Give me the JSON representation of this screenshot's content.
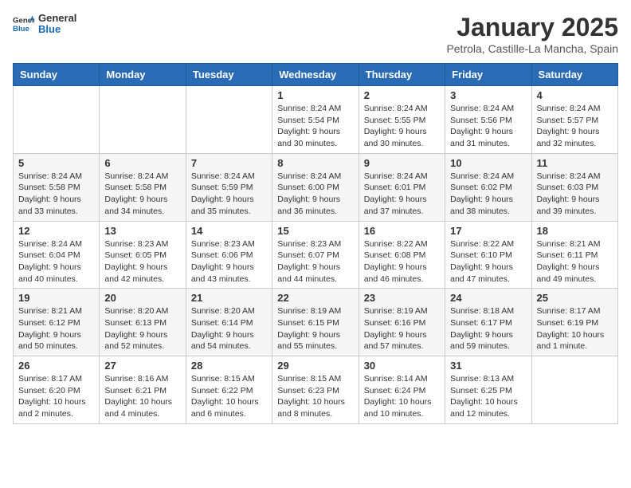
{
  "header": {
    "logo_general": "General",
    "logo_blue": "Blue",
    "month_title": "January 2025",
    "subtitle": "Petrola, Castille-La Mancha, Spain"
  },
  "weekdays": [
    "Sunday",
    "Monday",
    "Tuesday",
    "Wednesday",
    "Thursday",
    "Friday",
    "Saturday"
  ],
  "weeks": [
    [
      {
        "day": null,
        "info": null
      },
      {
        "day": null,
        "info": null
      },
      {
        "day": null,
        "info": null
      },
      {
        "day": "1",
        "info": "Sunrise: 8:24 AM\nSunset: 5:54 PM\nDaylight: 9 hours and 30 minutes."
      },
      {
        "day": "2",
        "info": "Sunrise: 8:24 AM\nSunset: 5:55 PM\nDaylight: 9 hours and 30 minutes."
      },
      {
        "day": "3",
        "info": "Sunrise: 8:24 AM\nSunset: 5:56 PM\nDaylight: 9 hours and 31 minutes."
      },
      {
        "day": "4",
        "info": "Sunrise: 8:24 AM\nSunset: 5:57 PM\nDaylight: 9 hours and 32 minutes."
      }
    ],
    [
      {
        "day": "5",
        "info": "Sunrise: 8:24 AM\nSunset: 5:58 PM\nDaylight: 9 hours and 33 minutes."
      },
      {
        "day": "6",
        "info": "Sunrise: 8:24 AM\nSunset: 5:58 PM\nDaylight: 9 hours and 34 minutes."
      },
      {
        "day": "7",
        "info": "Sunrise: 8:24 AM\nSunset: 5:59 PM\nDaylight: 9 hours and 35 minutes."
      },
      {
        "day": "8",
        "info": "Sunrise: 8:24 AM\nSunset: 6:00 PM\nDaylight: 9 hours and 36 minutes."
      },
      {
        "day": "9",
        "info": "Sunrise: 8:24 AM\nSunset: 6:01 PM\nDaylight: 9 hours and 37 minutes."
      },
      {
        "day": "10",
        "info": "Sunrise: 8:24 AM\nSunset: 6:02 PM\nDaylight: 9 hours and 38 minutes."
      },
      {
        "day": "11",
        "info": "Sunrise: 8:24 AM\nSunset: 6:03 PM\nDaylight: 9 hours and 39 minutes."
      }
    ],
    [
      {
        "day": "12",
        "info": "Sunrise: 8:24 AM\nSunset: 6:04 PM\nDaylight: 9 hours and 40 minutes."
      },
      {
        "day": "13",
        "info": "Sunrise: 8:23 AM\nSunset: 6:05 PM\nDaylight: 9 hours and 42 minutes."
      },
      {
        "day": "14",
        "info": "Sunrise: 8:23 AM\nSunset: 6:06 PM\nDaylight: 9 hours and 43 minutes."
      },
      {
        "day": "15",
        "info": "Sunrise: 8:23 AM\nSunset: 6:07 PM\nDaylight: 9 hours and 44 minutes."
      },
      {
        "day": "16",
        "info": "Sunrise: 8:22 AM\nSunset: 6:08 PM\nDaylight: 9 hours and 46 minutes."
      },
      {
        "day": "17",
        "info": "Sunrise: 8:22 AM\nSunset: 6:10 PM\nDaylight: 9 hours and 47 minutes."
      },
      {
        "day": "18",
        "info": "Sunrise: 8:21 AM\nSunset: 6:11 PM\nDaylight: 9 hours and 49 minutes."
      }
    ],
    [
      {
        "day": "19",
        "info": "Sunrise: 8:21 AM\nSunset: 6:12 PM\nDaylight: 9 hours and 50 minutes."
      },
      {
        "day": "20",
        "info": "Sunrise: 8:20 AM\nSunset: 6:13 PM\nDaylight: 9 hours and 52 minutes."
      },
      {
        "day": "21",
        "info": "Sunrise: 8:20 AM\nSunset: 6:14 PM\nDaylight: 9 hours and 54 minutes."
      },
      {
        "day": "22",
        "info": "Sunrise: 8:19 AM\nSunset: 6:15 PM\nDaylight: 9 hours and 55 minutes."
      },
      {
        "day": "23",
        "info": "Sunrise: 8:19 AM\nSunset: 6:16 PM\nDaylight: 9 hours and 57 minutes."
      },
      {
        "day": "24",
        "info": "Sunrise: 8:18 AM\nSunset: 6:17 PM\nDaylight: 9 hours and 59 minutes."
      },
      {
        "day": "25",
        "info": "Sunrise: 8:17 AM\nSunset: 6:19 PM\nDaylight: 10 hours and 1 minute."
      }
    ],
    [
      {
        "day": "26",
        "info": "Sunrise: 8:17 AM\nSunset: 6:20 PM\nDaylight: 10 hours and 2 minutes."
      },
      {
        "day": "27",
        "info": "Sunrise: 8:16 AM\nSunset: 6:21 PM\nDaylight: 10 hours and 4 minutes."
      },
      {
        "day": "28",
        "info": "Sunrise: 8:15 AM\nSunset: 6:22 PM\nDaylight: 10 hours and 6 minutes."
      },
      {
        "day": "29",
        "info": "Sunrise: 8:15 AM\nSunset: 6:23 PM\nDaylight: 10 hours and 8 minutes."
      },
      {
        "day": "30",
        "info": "Sunrise: 8:14 AM\nSunset: 6:24 PM\nDaylight: 10 hours and 10 minutes."
      },
      {
        "day": "31",
        "info": "Sunrise: 8:13 AM\nSunset: 6:25 PM\nDaylight: 10 hours and 12 minutes."
      },
      {
        "day": null,
        "info": null
      }
    ]
  ]
}
